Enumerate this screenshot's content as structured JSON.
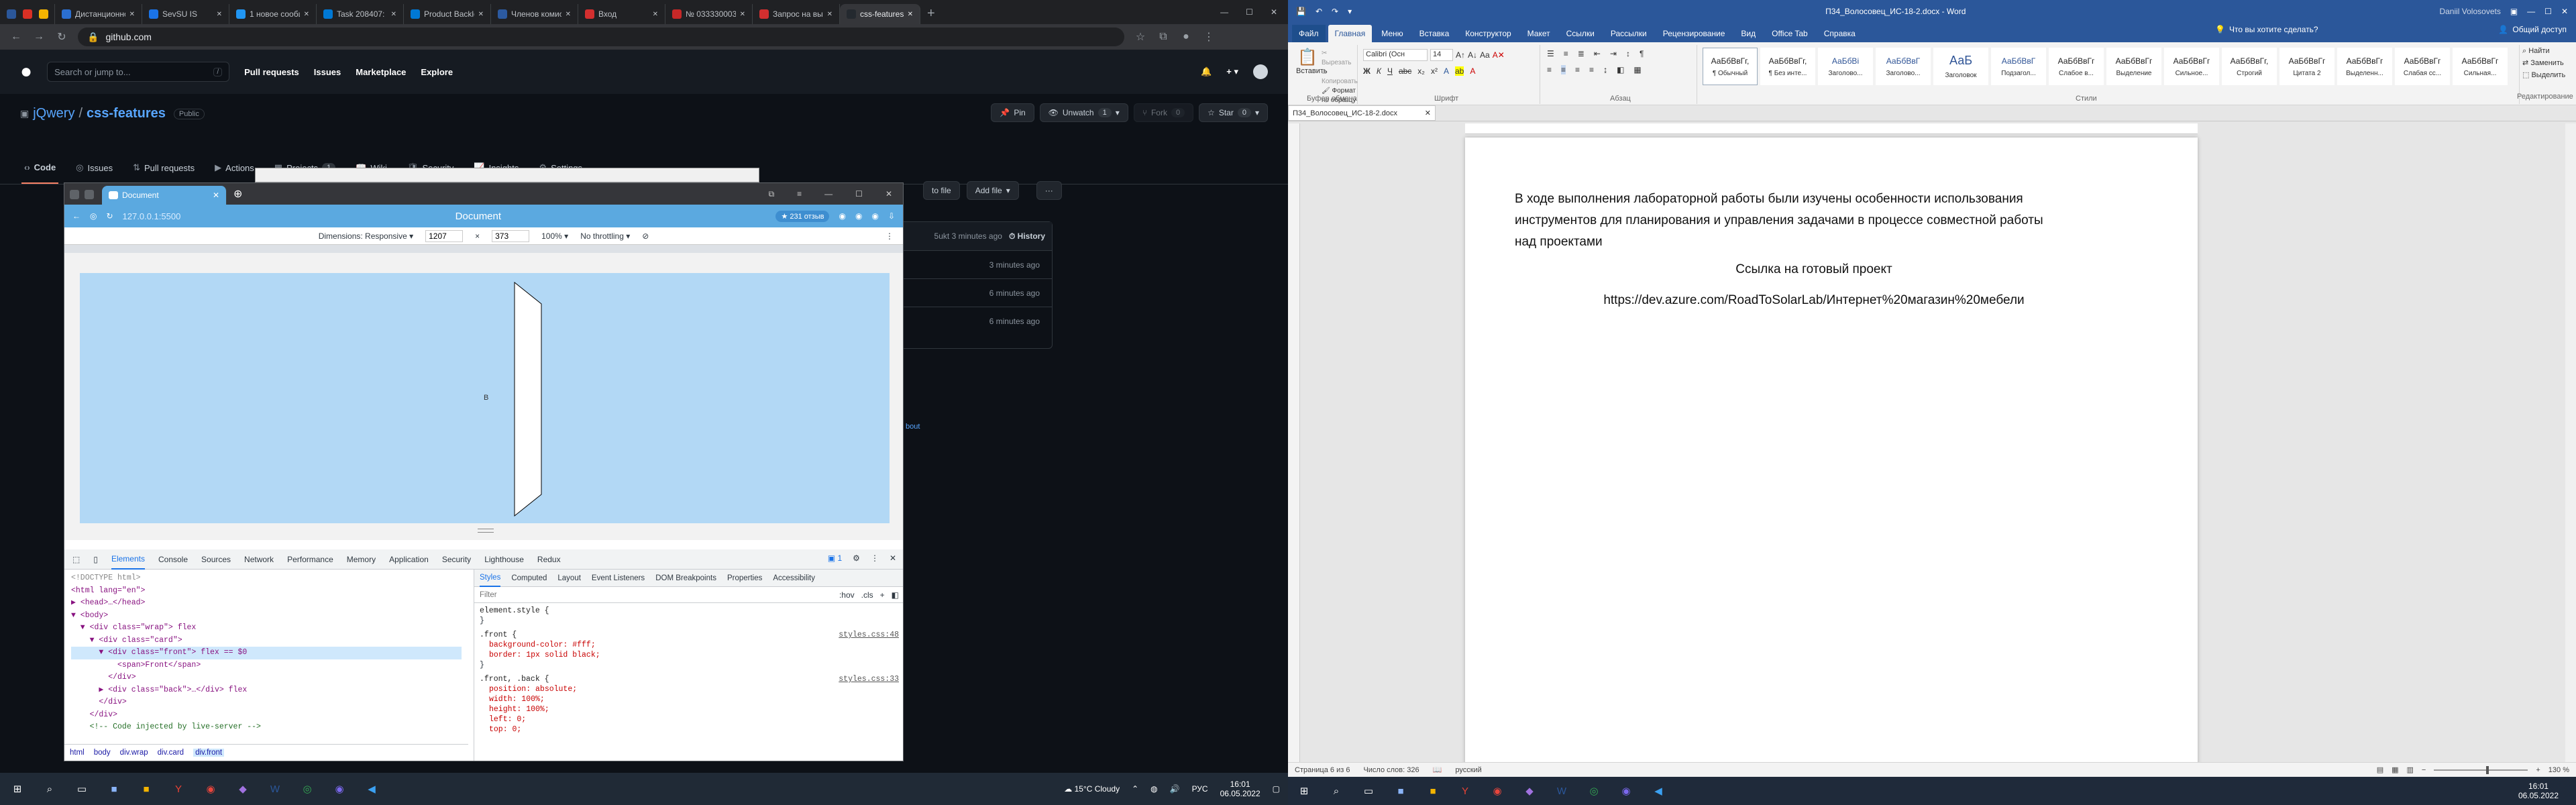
{
  "left": {
    "browser": {
      "tabs": [
        {
          "label": "Дистанционное",
          "color": "#2b6fd1"
        },
        {
          "label": "SevSU IS",
          "color": "#1a73e8"
        },
        {
          "label": "1 новое сообщ...",
          "color": "#2196f3"
        },
        {
          "label": "Task 208407: [E...",
          "color": "#0078d4"
        },
        {
          "label": "Product Backlog",
          "color": "#0078d4"
        },
        {
          "label": "Членов комисс...",
          "color": "#2c5aa0"
        },
        {
          "label": "Вход",
          "color": "#d32f2f"
        },
        {
          "label": "№ 0333300031...",
          "color": "#c62828"
        },
        {
          "label": "Запрос на выте...",
          "color": "#d32f2f"
        },
        {
          "label": "css-features",
          "color": "#24292f"
        }
      ],
      "url": "github.com"
    },
    "github": {
      "search_placeholder": "Search or jump to...",
      "search_hint": "/",
      "nav": [
        "Pull requests",
        "Issues",
        "Marketplace",
        "Explore"
      ],
      "owner": "jQwery",
      "repo": "css-features",
      "visibility": "Public",
      "pin": "Pin",
      "unwatch": "Unwatch",
      "unwatch_count": "1",
      "fork": "Fork",
      "fork_count": "0",
      "star": "Star",
      "star_count": "0",
      "tabs": [
        {
          "label": "Code",
          "count": ""
        },
        {
          "label": "Issues",
          "count": ""
        },
        {
          "label": "Pull requests",
          "count": ""
        },
        {
          "label": "Actions",
          "count": ""
        },
        {
          "label": "Projects",
          "count": "1"
        },
        {
          "label": "Wiki",
          "count": ""
        },
        {
          "label": "Security",
          "count": ""
        },
        {
          "label": "Insights",
          "count": ""
        },
        {
          "label": "Settings",
          "count": ""
        }
      ],
      "go_to_file": "to file",
      "add_file": "Add file",
      "commit_meta": "5ukt 3 minutes ago",
      "history": "History",
      "file_times": [
        "3 minutes ago",
        "6 minutes ago",
        "6 minutes ago"
      ],
      "readme_link": "bout"
    },
    "window": {
      "tab_title": "Document",
      "url": "127.0.0.1:5500",
      "page_title": "Document",
      "pill": "231 отзыв",
      "dimensions_label": "Dimensions: Responsive",
      "width": "1207",
      "height": "373",
      "zoom": "100%",
      "throttle": "No throttling",
      "card_text": "B"
    },
    "devtools": {
      "tabs": [
        "Elements",
        "Console",
        "Sources",
        "Network",
        "Performance",
        "Memory",
        "Application",
        "Security",
        "Lighthouse",
        "Redux"
      ],
      "issues_count": "1",
      "tree": [
        "<!DOCTYPE html>",
        "<html lang=\"en\">",
        "▶ <head>…</head>",
        "▼ <body>",
        "  ▼ <div class=\"wrap\"> flex",
        "    ▼ <div class=\"card\">",
        "      ▼ <div class=\"front\"> flex == $0",
        "          <span>Front</span>",
        "        </div>",
        "      ▶ <div class=\"back\">…</div> flex",
        "      </div>",
        "    </div>",
        "    <!-- Code injected by live-server -->"
      ],
      "style_tabs": [
        "Styles",
        "Computed",
        "Layout",
        "Event Listeners",
        "DOM Breakpoints",
        "Properties",
        "Accessibility"
      ],
      "filter_placeholder": "Filter",
      "hov": ":hov",
      "cls": ".cls",
      "rules": [
        {
          "selector": "element.style {",
          "source": "",
          "props": [],
          "close": "}"
        },
        {
          "selector": ".front {",
          "source": "styles.css:48",
          "props": [
            "background-color: #fff;",
            "border: 1px solid black;"
          ],
          "close": "}"
        },
        {
          "selector": ".front, .back {",
          "source": "styles.css:33",
          "props": [
            "position: absolute;",
            "width: 100%;",
            "height: 100%;",
            "left: 0;",
            "top: 0;"
          ],
          "close": ""
        }
      ],
      "breadcrumbs": [
        "html",
        "body",
        "div.wrap",
        "div.card",
        "div.front"
      ]
    },
    "taskbar": {
      "weather": "15°C Cloudy",
      "lang": "РУС",
      "time": "16:01",
      "date": "06.05.2022"
    }
  },
  "right": {
    "title": "П34_Волосовец_ИС-18-2.docx - Word",
    "user": "Daniil Volosovets",
    "ribbon_tabs": [
      "Файл",
      "Главная",
      "Меню",
      "Вставка",
      "Конструктор",
      "Макет",
      "Ссылки",
      "Рассылки",
      "Рецензирование",
      "Вид",
      "Office Tab",
      "Справка"
    ],
    "tell_me": "Что вы хотите сделать?",
    "share": "Общий доступ",
    "clipboard": {
      "paste": "Вставить",
      "cut": "Вырезать",
      "copy": "Копировать",
      "format": "Формат по образцу",
      "group": "Буфер обмена"
    },
    "font": {
      "name": "Calibri (Осн",
      "size": "14",
      "group": "Шрифт"
    },
    "paragraph_group": "Абзац",
    "styles": [
      {
        "preview": "АаБбВвГг,",
        "name": "¶ Обычный"
      },
      {
        "preview": "АаБбВвГг,",
        "name": "¶ Без инте..."
      },
      {
        "preview": "АаБбВі",
        "name": "Заголово..."
      },
      {
        "preview": "АаБбВвГ",
        "name": "Заголово..."
      },
      {
        "preview": "АаБ",
        "name": "Заголовок"
      },
      {
        "preview": "АаБбВвГ",
        "name": "Подзагол..."
      },
      {
        "preview": "АаБбВвГг",
        "name": "Слабое в..."
      },
      {
        "preview": "АаБбВвГг",
        "name": "Выделение"
      },
      {
        "preview": "АаБбВвГг",
        "name": "Сильное..."
      },
      {
        "preview": "АаБбВвГг,",
        "name": "Строгий"
      },
      {
        "preview": "АаБбВвГг",
        "name": "Цитата 2"
      },
      {
        "preview": "АаБбВвГг",
        "name": "Выделенн..."
      },
      {
        "preview": "АаБбВвГг",
        "name": "Слабая сс..."
      },
      {
        "preview": "АаБбВвГг",
        "name": "Сильная..."
      }
    ],
    "styles_group": "Стили",
    "editing": {
      "find": "Найти",
      "replace": "Заменить",
      "select": "Выделить",
      "group": "Редактирование"
    },
    "doc_tab": "П34_Волосовец_ИС-18-2.docx",
    "body": [
      "В ходе выполнения лабораторной работы были изучены особенности использования инструментов для планирования и управления задачами в процессе совместной работы над проектами",
      "Ссылка на готовый проект",
      "https://dev.azure.com/RoadToSolarLab/Интернет%20магазин%20мебели"
    ],
    "status": {
      "page": "Страница 6 из 6",
      "words": "Число слов: 326",
      "lang": "русский",
      "zoom": "130 %"
    },
    "taskbar": {
      "time": "16:01",
      "date": "06.05.2022"
    }
  }
}
